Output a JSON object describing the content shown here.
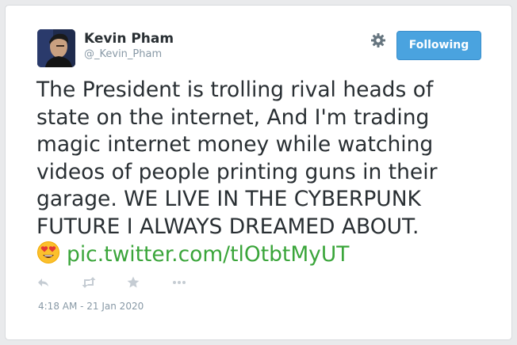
{
  "author": {
    "name": "Kevin Pham",
    "handle": "@_Kevin_Pham",
    "avatar_icon": "avatar-photo"
  },
  "header": {
    "settings_icon": "gear-icon",
    "follow_button_label": "Following"
  },
  "tweet": {
    "text": "The President is trolling rival heads of state on the internet, And I'm trading magic internet money while watching videos of people printing guns in their garage. WE LIVE IN THE CYBERPUNK FUTURE I ALWAYS DREAMED ABOUT.",
    "emoji": "heart-eyes-emoji",
    "link": "pic.twitter.com/tlOtbtMyUT"
  },
  "actions": [
    "reply-icon",
    "retweet-icon",
    "favorite-icon",
    "more-icon"
  ],
  "timestamp": "4:18 AM - 21 Jan 2020",
  "colors": {
    "follow_button": "#4aa3df",
    "link": "#3aa53a",
    "text": "#292f33",
    "muted": "#8899a6"
  }
}
